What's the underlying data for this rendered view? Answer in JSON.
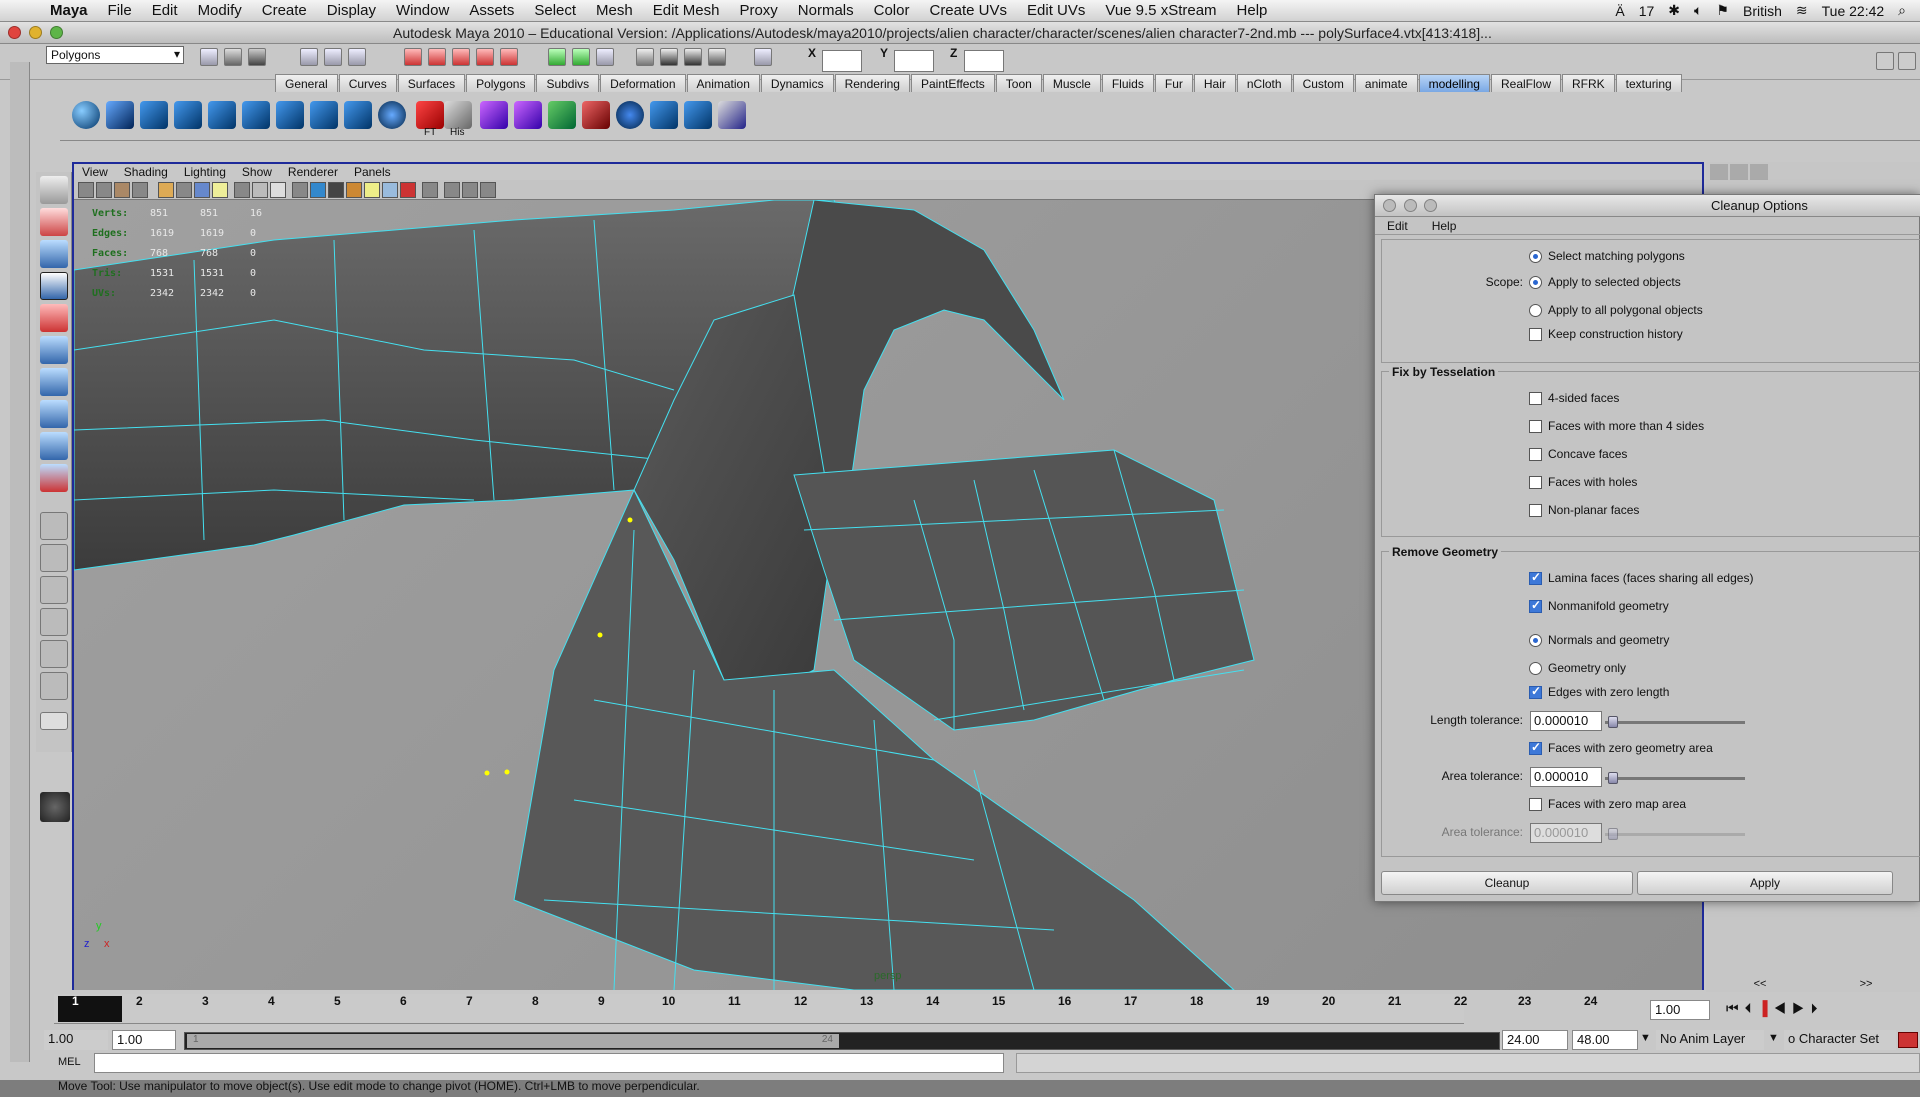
{
  "menubar": {
    "app": "Maya",
    "items": [
      "File",
      "Edit",
      "Modify",
      "Create",
      "Display",
      "Window",
      "Assets",
      "Select",
      "Mesh",
      "Edit Mesh",
      "Proxy",
      "Normals",
      "Color",
      "Create UVs",
      "Edit UVs",
      "Vue 9.5 xStream",
      "Help"
    ],
    "status": {
      "adobe": "17",
      "language": "British",
      "clock": "Tue 22:42"
    }
  },
  "window": {
    "title": "Autodesk Maya 2010 – Educational Version: /Applications/Autodesk/maya2010/projects/alien character/character/scenes/alien character7-2nd.mb   ---   polySurface4.vtx[413:418]..."
  },
  "statusline": {
    "menuset": "Polygons",
    "x_label": "X",
    "y_label": "Y",
    "z_label": "Z"
  },
  "shelf": {
    "tabs": [
      "General",
      "Curves",
      "Surfaces",
      "Polygons",
      "Subdivs",
      "Deformation",
      "Animation",
      "Dynamics",
      "Rendering",
      "PaintEffects",
      "Toon",
      "Muscle",
      "Fluids",
      "Fur",
      "Hair",
      "nCloth",
      "Custom",
      "animate",
      "modelling",
      "RealFlow",
      "RFRK",
      "texturing"
    ],
    "active_tab": "modelling",
    "labels": {
      "ft": "FT",
      "his": "His"
    }
  },
  "panel": {
    "menus": [
      "View",
      "Shading",
      "Lighting",
      "Show",
      "Renderer",
      "Panels"
    ],
    "camera": "persp",
    "hud": [
      {
        "label": "Verts:",
        "a": "851",
        "b": "851",
        "c": "16"
      },
      {
        "label": "Edges:",
        "a": "1619",
        "b": "1619",
        "c": "0"
      },
      {
        "label": "Faces:",
        "a": "768",
        "b": "768",
        "c": "0"
      },
      {
        "label": "Tris:",
        "a": "1531",
        "b": "1531",
        "c": "0"
      },
      {
        "label": "UVs:",
        "a": "2342",
        "b": "2342",
        "c": "0"
      }
    ],
    "axis_y": "y",
    "axis_x": "x"
  },
  "cleanup": {
    "title": "Cleanup Options",
    "menu": [
      "Edit",
      "Help"
    ],
    "scope_label": "Scope:",
    "select_matching": "Select matching polygons",
    "apply_selected": "Apply to selected objects",
    "apply_all": "Apply to all polygonal objects",
    "keep_history": "Keep construction history",
    "fix_header": "Fix by Tesselation",
    "four_sided": "4-sided faces",
    "more_than_four": "Faces with more than 4 sides",
    "concave": "Concave faces",
    "holes": "Faces with holes",
    "nonplanar": "Non-planar faces",
    "remove_header": "Remove Geometry",
    "lamina": "Lamina faces (faces sharing all edges)",
    "nonmanifold": "Nonmanifold geometry",
    "normals_geo": "Normals and geometry",
    "geo_only": "Geometry only",
    "zero_length": "Edges with zero length",
    "length_tol_label": "Length tolerance:",
    "length_tol": "0.000010",
    "zero_geo_area": "Faces with zero geometry area",
    "area_tol_label": "Area tolerance:",
    "area_tol": "0.000010",
    "zero_map_area": "Faces with zero map area",
    "map_tol_label": "Area tolerance:",
    "map_tol": "0.000010",
    "btn_cleanup": "Cleanup",
    "btn_apply": "Apply"
  },
  "timeline": {
    "ticks": [
      "1",
      "2",
      "3",
      "4",
      "5",
      "6",
      "7",
      "8",
      "9",
      "10",
      "11",
      "12",
      "13",
      "14",
      "15",
      "16",
      "17",
      "18",
      "19",
      "20",
      "21",
      "22",
      "23",
      "24"
    ],
    "current": "1.00",
    "start": "1.00",
    "start2": "1.00",
    "range_end": "24.00",
    "end": "48.00",
    "range_left": "1",
    "range_right": "24",
    "anim_layer": "No Anim Layer",
    "char_set": "o Character Set",
    "nav_prev": "<<",
    "nav_next": ">>"
  },
  "cmdline": {
    "label": "MEL"
  },
  "help": "Move Tool: Use manipulator to move object(s). Use edit mode to change pivot (HOME).  Ctrl+LMB to move perpendicular.",
  "colors": {
    "viewport_bg": "#9a9a9a",
    "wire": "#44e0f0",
    "accent": "#1e2a9a"
  }
}
